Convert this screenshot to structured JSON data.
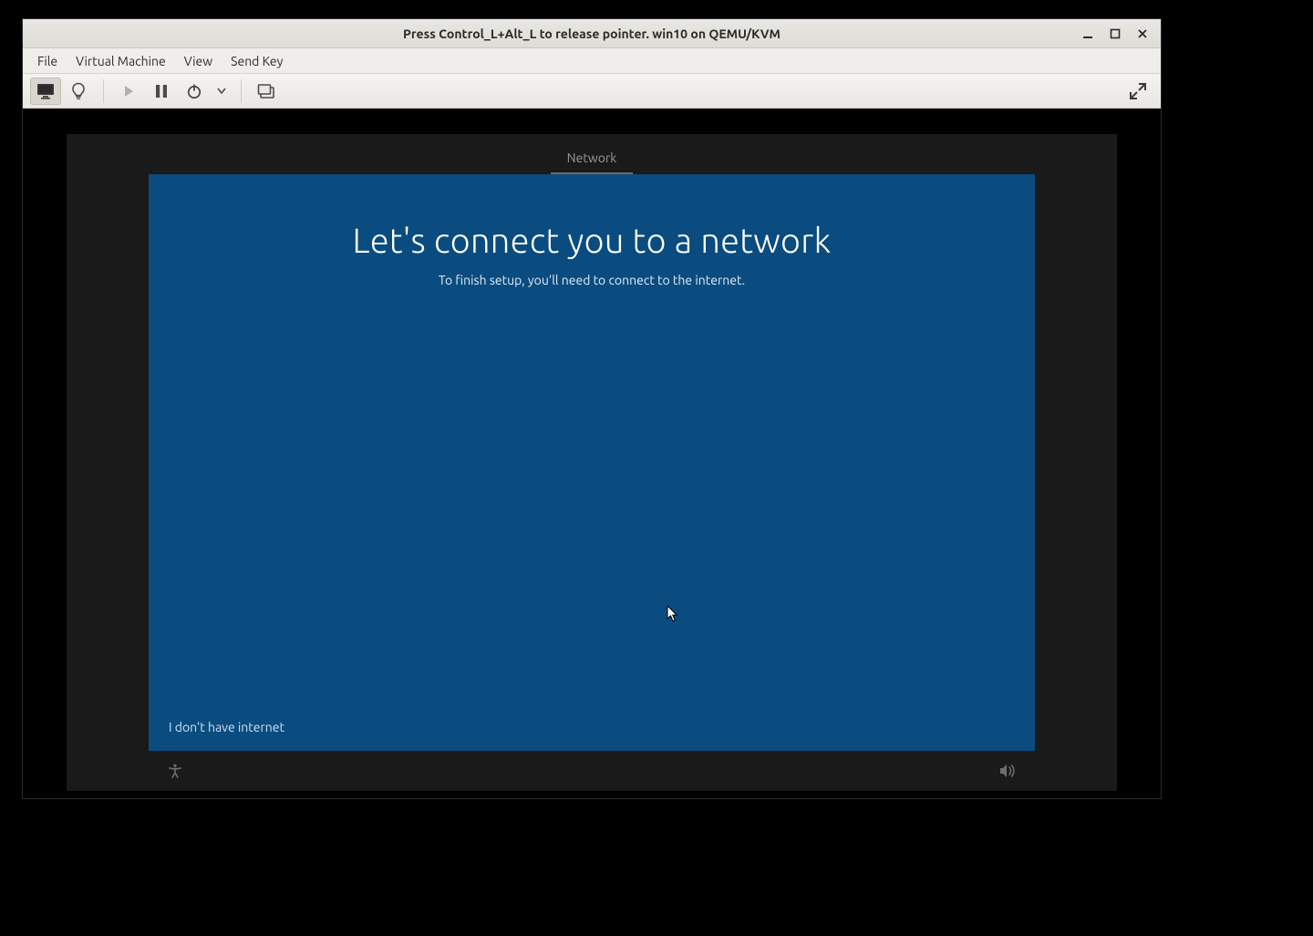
{
  "titlebar": {
    "title": "Press Control_L+Alt_L to release pointer. win10 on QEMU/KVM"
  },
  "menubar": {
    "items": [
      "File",
      "Virtual Machine",
      "View",
      "Send Key"
    ]
  },
  "toolbar": {
    "monitor_icon": "monitor-icon",
    "bulb_icon": "lightbulb-icon",
    "play_icon": "play-icon",
    "pause_icon": "pause-icon",
    "power_icon": "power-icon",
    "dropdown_icon": "chevron-down-icon",
    "screenshot_icon": "screenshot-icon",
    "fullscreen_icon": "fullscreen-icon"
  },
  "guest": {
    "tab_label": "Network",
    "headline": "Let's connect you to a network",
    "subtext": "To finish setup, you'll need to connect to the internet.",
    "no_internet_link": "I don't have internet",
    "accessibility_icon": "accessibility-icon",
    "volume_icon": "volume-icon"
  }
}
